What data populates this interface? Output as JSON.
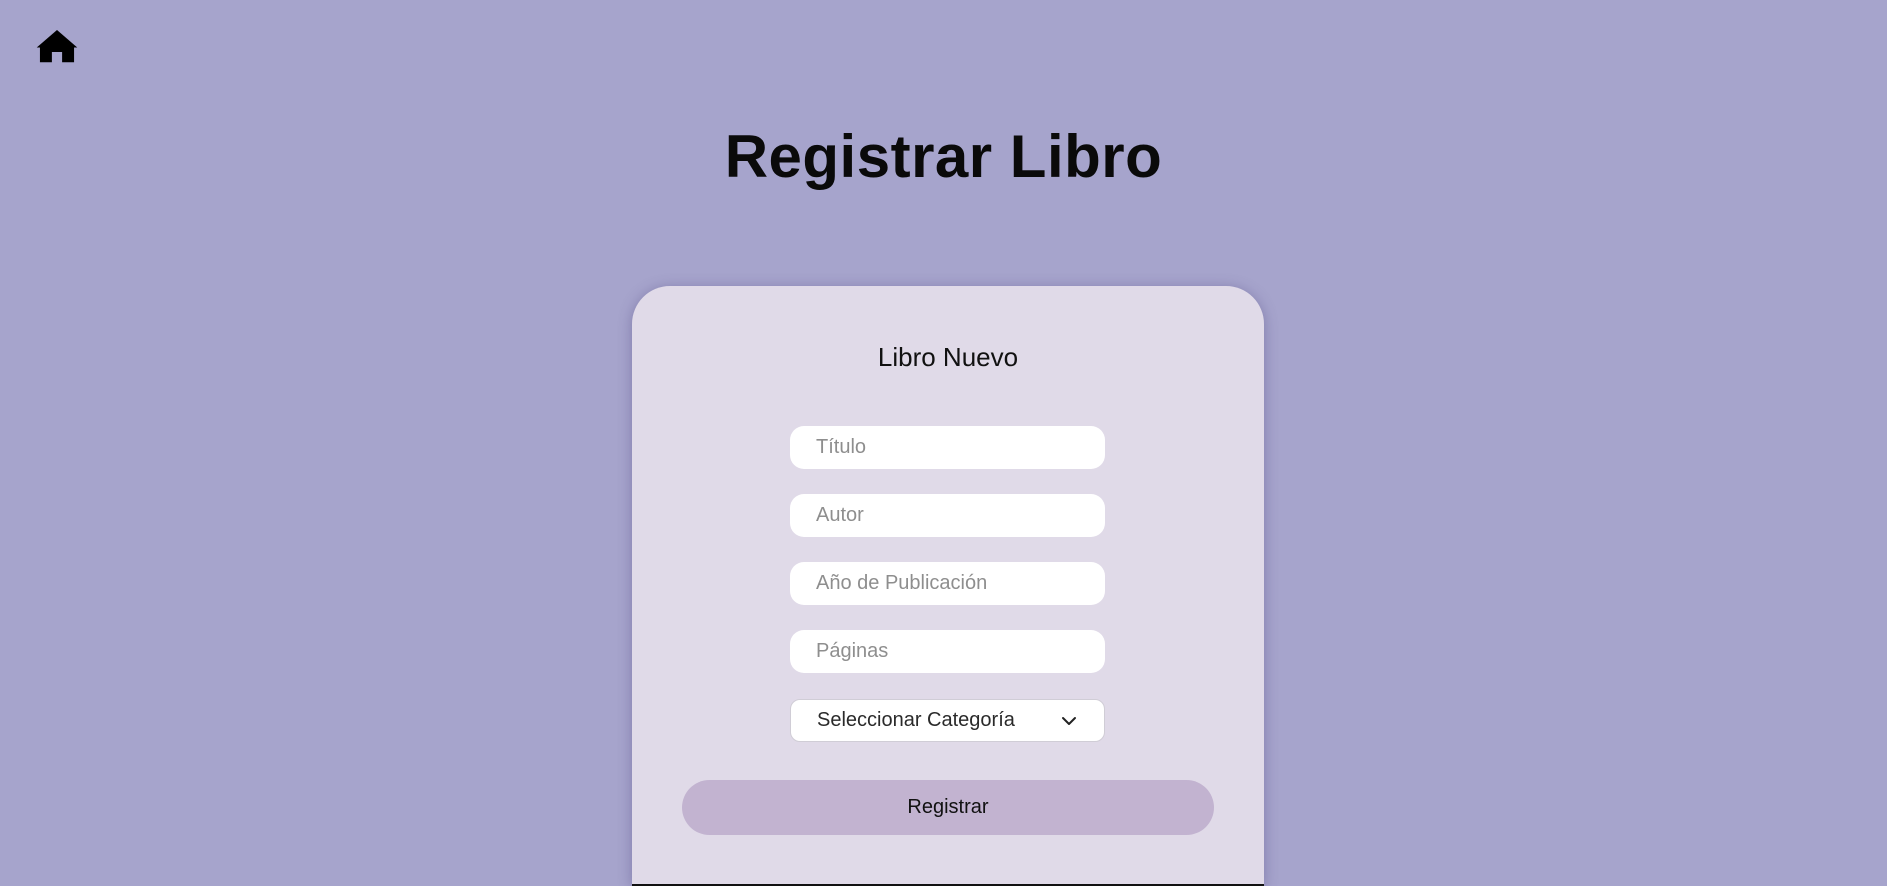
{
  "nav": {
    "home_icon": "home-icon"
  },
  "header": {
    "title": "Registrar Libro"
  },
  "form": {
    "title": "Libro Nuevo",
    "fields": {
      "titulo_placeholder": "Título",
      "autor_placeholder": "Autor",
      "anio_placeholder": "Año de Publicación",
      "paginas_placeholder": "Páginas"
    },
    "category": {
      "selected": "Seleccionar Categoría",
      "icon": "chevron-down-icon"
    },
    "submit_label": "Registrar"
  },
  "colors": {
    "background": "#a6a4cc",
    "card": "#e0dae8",
    "button": "#c2b3d0",
    "input": "#ffffff"
  }
}
